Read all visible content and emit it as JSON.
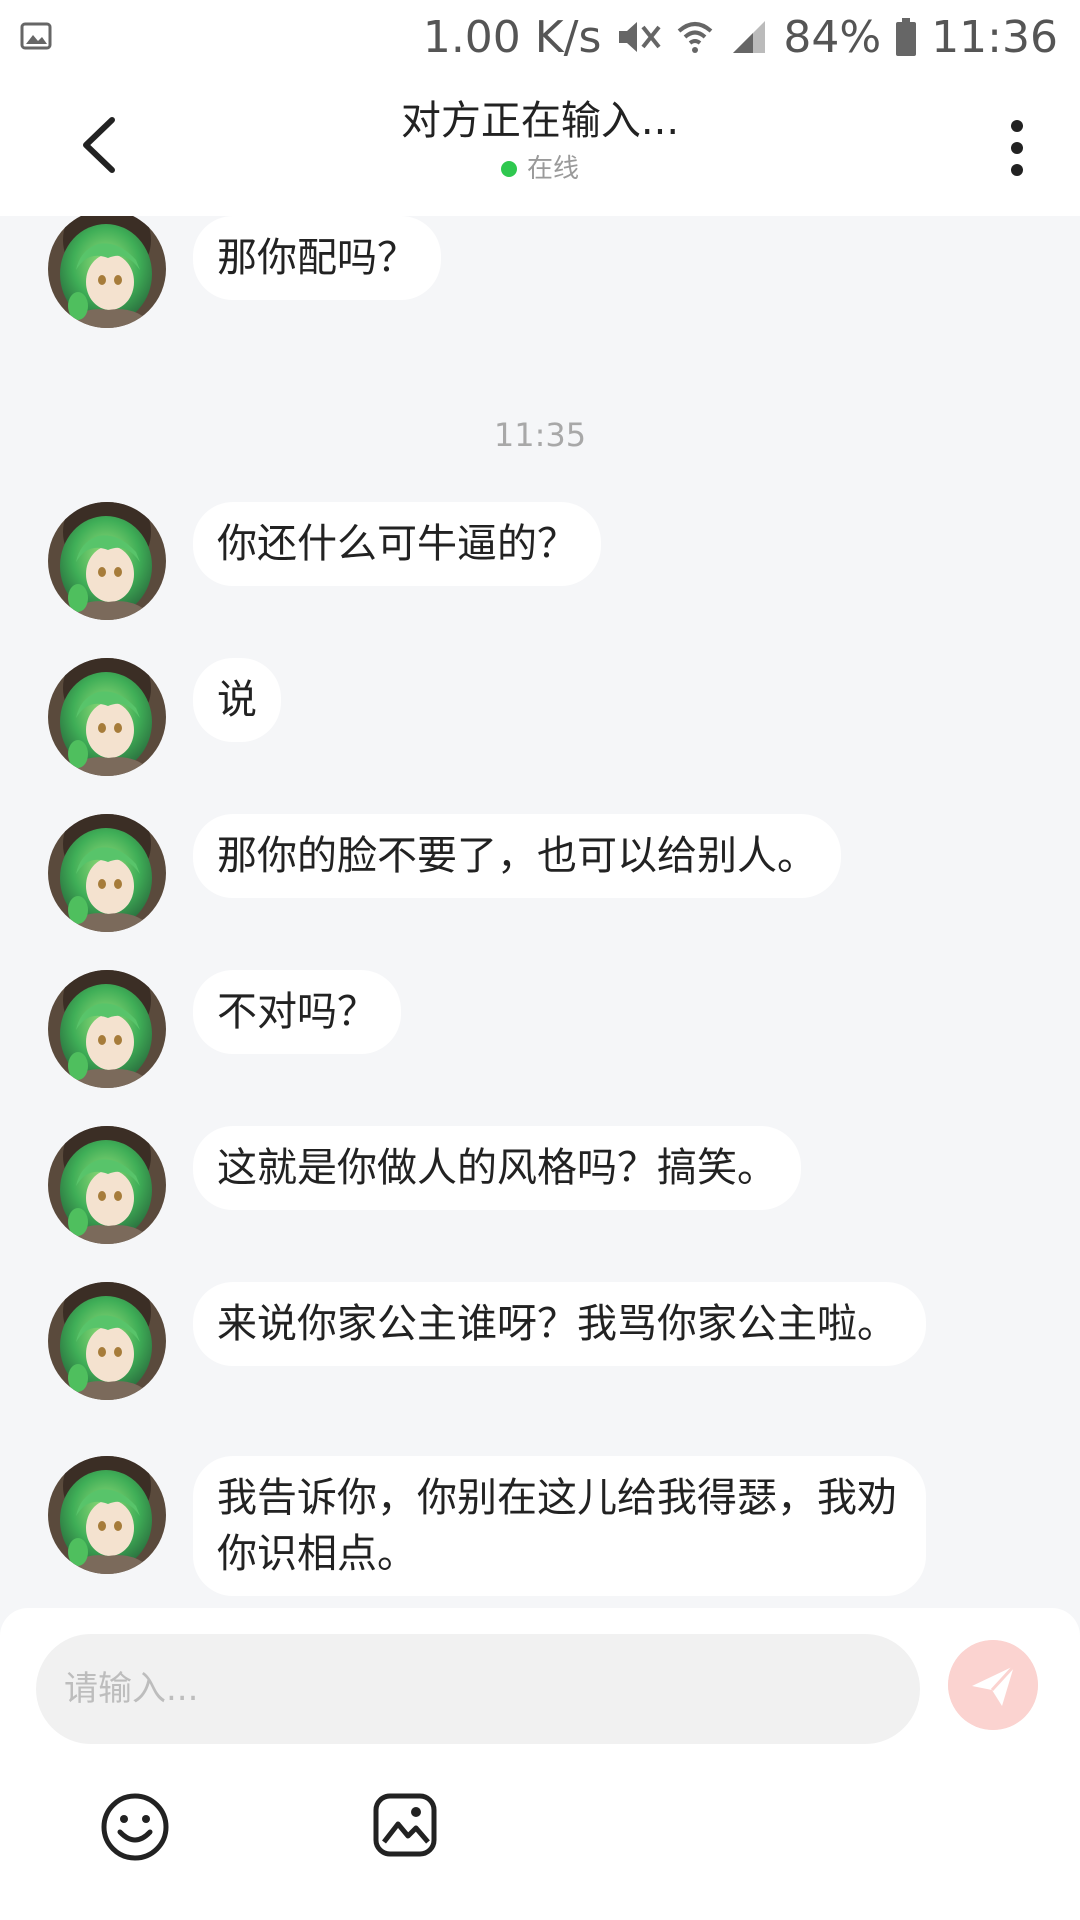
{
  "status_bar": {
    "speed": "1.00 K/s",
    "battery": "84%",
    "time": "11:36",
    "icons": [
      "gallery-icon",
      "mute-icon",
      "wifi-icon",
      "signal-icon",
      "battery-icon"
    ]
  },
  "header": {
    "title": "对方正在输入...",
    "status": "在线",
    "status_color": "#2fc84f"
  },
  "chat": {
    "timestamp": "11:35",
    "messages": [
      {
        "text": "那你配吗？"
      },
      {
        "text": "你还什么可牛逼的？"
      },
      {
        "text": "说"
      },
      {
        "text": "那你的脸不要了，也可以给别人。"
      },
      {
        "text": "不对吗？"
      },
      {
        "text": "这就是你做人的风格吗？搞笑。"
      },
      {
        "text": "来说你家公主谁呀？我骂你家公主啦。"
      },
      {
        "text": "我告诉你，你别在这儿给我得瑟，我劝你识相点。"
      }
    ]
  },
  "input": {
    "placeholder": "请输入..."
  },
  "colors": {
    "background": "#f5f6f8",
    "bubble": "#ffffff",
    "send_button": "#fbd3d0"
  }
}
